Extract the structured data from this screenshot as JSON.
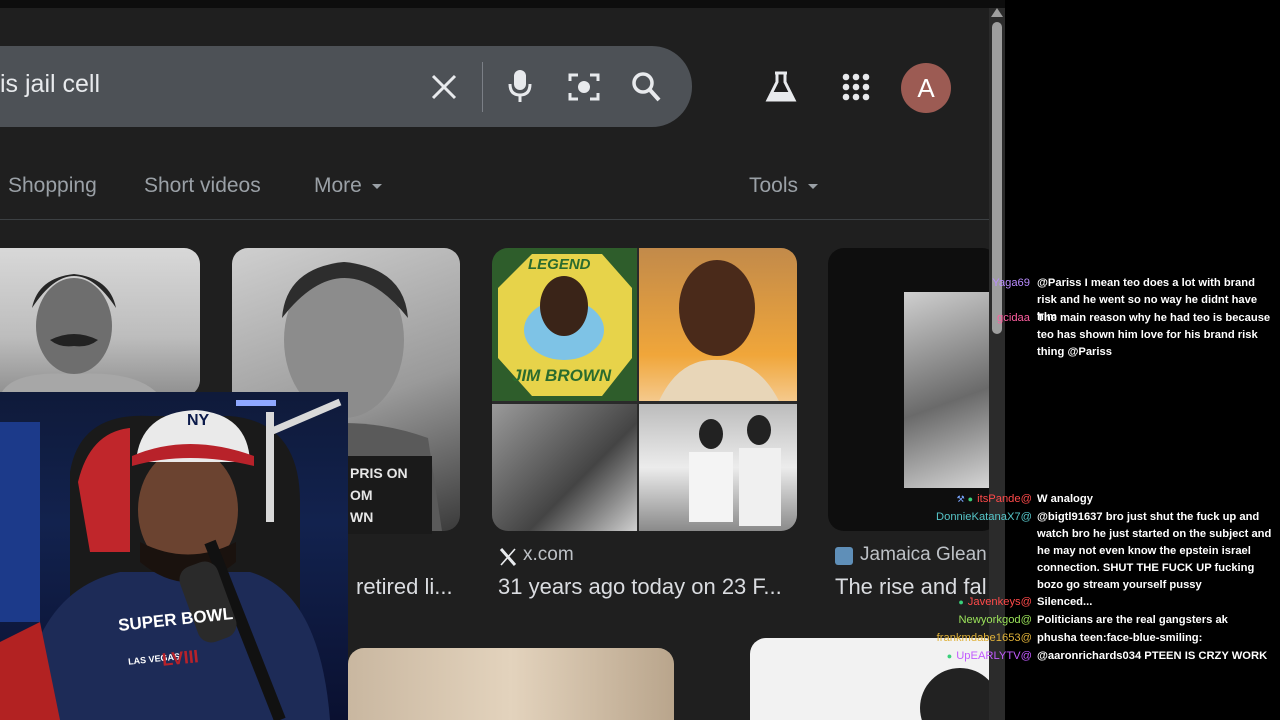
{
  "search": {
    "query": "is jail cell",
    "avatar_letter": "A"
  },
  "tabs": {
    "shopping": "Shopping",
    "short_videos": "Short videos",
    "more": "More",
    "tools": "Tools"
  },
  "results": [
    {
      "source": "",
      "title": "retired li..."
    },
    {
      "source": "x.com",
      "title": "31 years ago today on 23 F..."
    },
    {
      "source": "Jamaica Glean",
      "title": "The rise and fal"
    }
  ],
  "image_text": {
    "legend_top": "LEGEND",
    "legend_bottom": "JIM BROWN",
    "sign_lines": [
      "PRIS ON",
      "OM",
      "WN"
    ]
  },
  "webcam": {
    "cap_logo": "NY",
    "shirt_line1": "SUPER BOWL",
    "shirt_line2": "LAS VEGAS",
    "shirt_line3": "LVIII"
  },
  "chat": [
    {
      "user": "Yaga69",
      "color": "#b98cff",
      "text": "@Pariss I mean teo does a lot with brand risk and he went so no way he didnt have him"
    },
    {
      "user": "gcidaa",
      "color": "#ff5fa0",
      "text": "The main reason why he had teo is because teo has shown him love for his brand risk thing @Pariss"
    },
    {
      "user": "@itsPande",
      "color": "#ff4a4a",
      "text": "W analogy"
    },
    {
      "user": "@DonnieKatanaX7",
      "color": "#56c5c8",
      "text": "@bigtl91637 bro just shut the fuck up and watch bro he just started on the subject and he may not even know the epstein israel connection. SHUT THE FUCK UP fucking bozo go stream yourself pussy"
    },
    {
      "user": "@Javenkeys",
      "color": "#ff4a4a",
      "text": "Silenced..."
    },
    {
      "user": "@Newyorkgod",
      "color": "#9be35a",
      "text": "Politicians are the real gangsters ak"
    },
    {
      "user": "@frankmdabe1653",
      "color": "#e0b23a",
      "text": "phusha teen:face-blue-smiling:"
    },
    {
      "user": "@UpEARLYTV",
      "color": "#c25bff",
      "text": "@aaronrichards034 PTEEN IS CRZY WORK"
    }
  ]
}
